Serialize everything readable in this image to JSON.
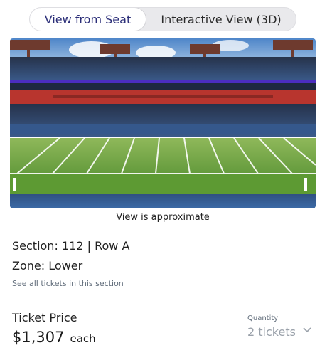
{
  "view_toggle": {
    "options": [
      {
        "label": "View from Seat",
        "selected": true
      },
      {
        "label": "Interactive View (3D)",
        "selected": false
      }
    ]
  },
  "seat_view": {
    "caption": "View is approximate"
  },
  "seat_info": {
    "section_label": "Section:",
    "section": "112",
    "separator": "|",
    "row_label": "Row",
    "row": "A",
    "zone_label": "Zone:",
    "zone": "Lower",
    "see_all_link": "See all tickets in this section"
  },
  "pricing": {
    "label": "Ticket Price",
    "price": "$1,307",
    "unit": "each"
  },
  "quantity": {
    "label": "Quantity",
    "value": "2 tickets"
  },
  "colors": {
    "accent": "#2b2e78",
    "field_green": "#5d9a33",
    "seat_blue": "#2c4a78",
    "seat_red": "#b8352e",
    "ribbon_purple": "#4b2dbf",
    "sky": "#6f9fd4",
    "muted_text": "#5e6a78"
  }
}
